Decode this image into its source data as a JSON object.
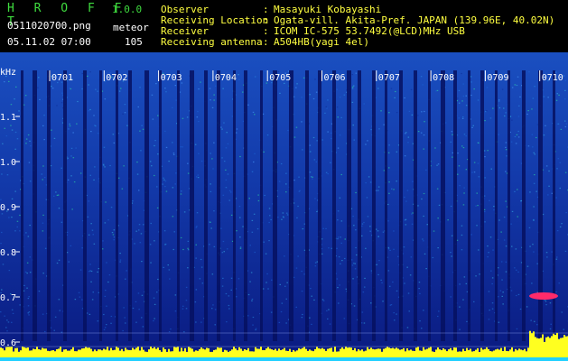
{
  "app": {
    "title": "H R O F F T",
    "version": "1.0.0"
  },
  "file": {
    "name": "0511020700.png",
    "mode": "meteor",
    "datetime": "05.11.02 07:00",
    "count": "105"
  },
  "info": [
    {
      "key": "Observer",
      "value": "Masayuki Kobayashi"
    },
    {
      "key": "Receiving Location",
      "value": "Ogata-vill. Akita-Pref. JAPAN (139.96E, 40.02N)"
    },
    {
      "key": "Receiver",
      "value": "ICOM IC-575 53.7492(@LCD)MHz USB"
    },
    {
      "key": "Receiving antenna",
      "value": "A504HB(yagi 4el)"
    }
  ],
  "spectrogram": {
    "y_unit": "kHz",
    "y_ticks": [
      "1.1",
      "1.0",
      "0.9",
      "0.8",
      "0.7",
      "0.6"
    ],
    "time_ticks": [
      "0701",
      "0702",
      "0703",
      "0704",
      "0705",
      "0706",
      "0707",
      "0708",
      "0709",
      "0710"
    ],
    "colors": {
      "background": "#0a1a8a",
      "noise_high": "#2ee6a0",
      "meteor_echo": "#ff2a6a",
      "baseline_spectrum": "#ffff20",
      "floor": "#20d0ff",
      "tick_label": "#ffffff"
    }
  }
}
